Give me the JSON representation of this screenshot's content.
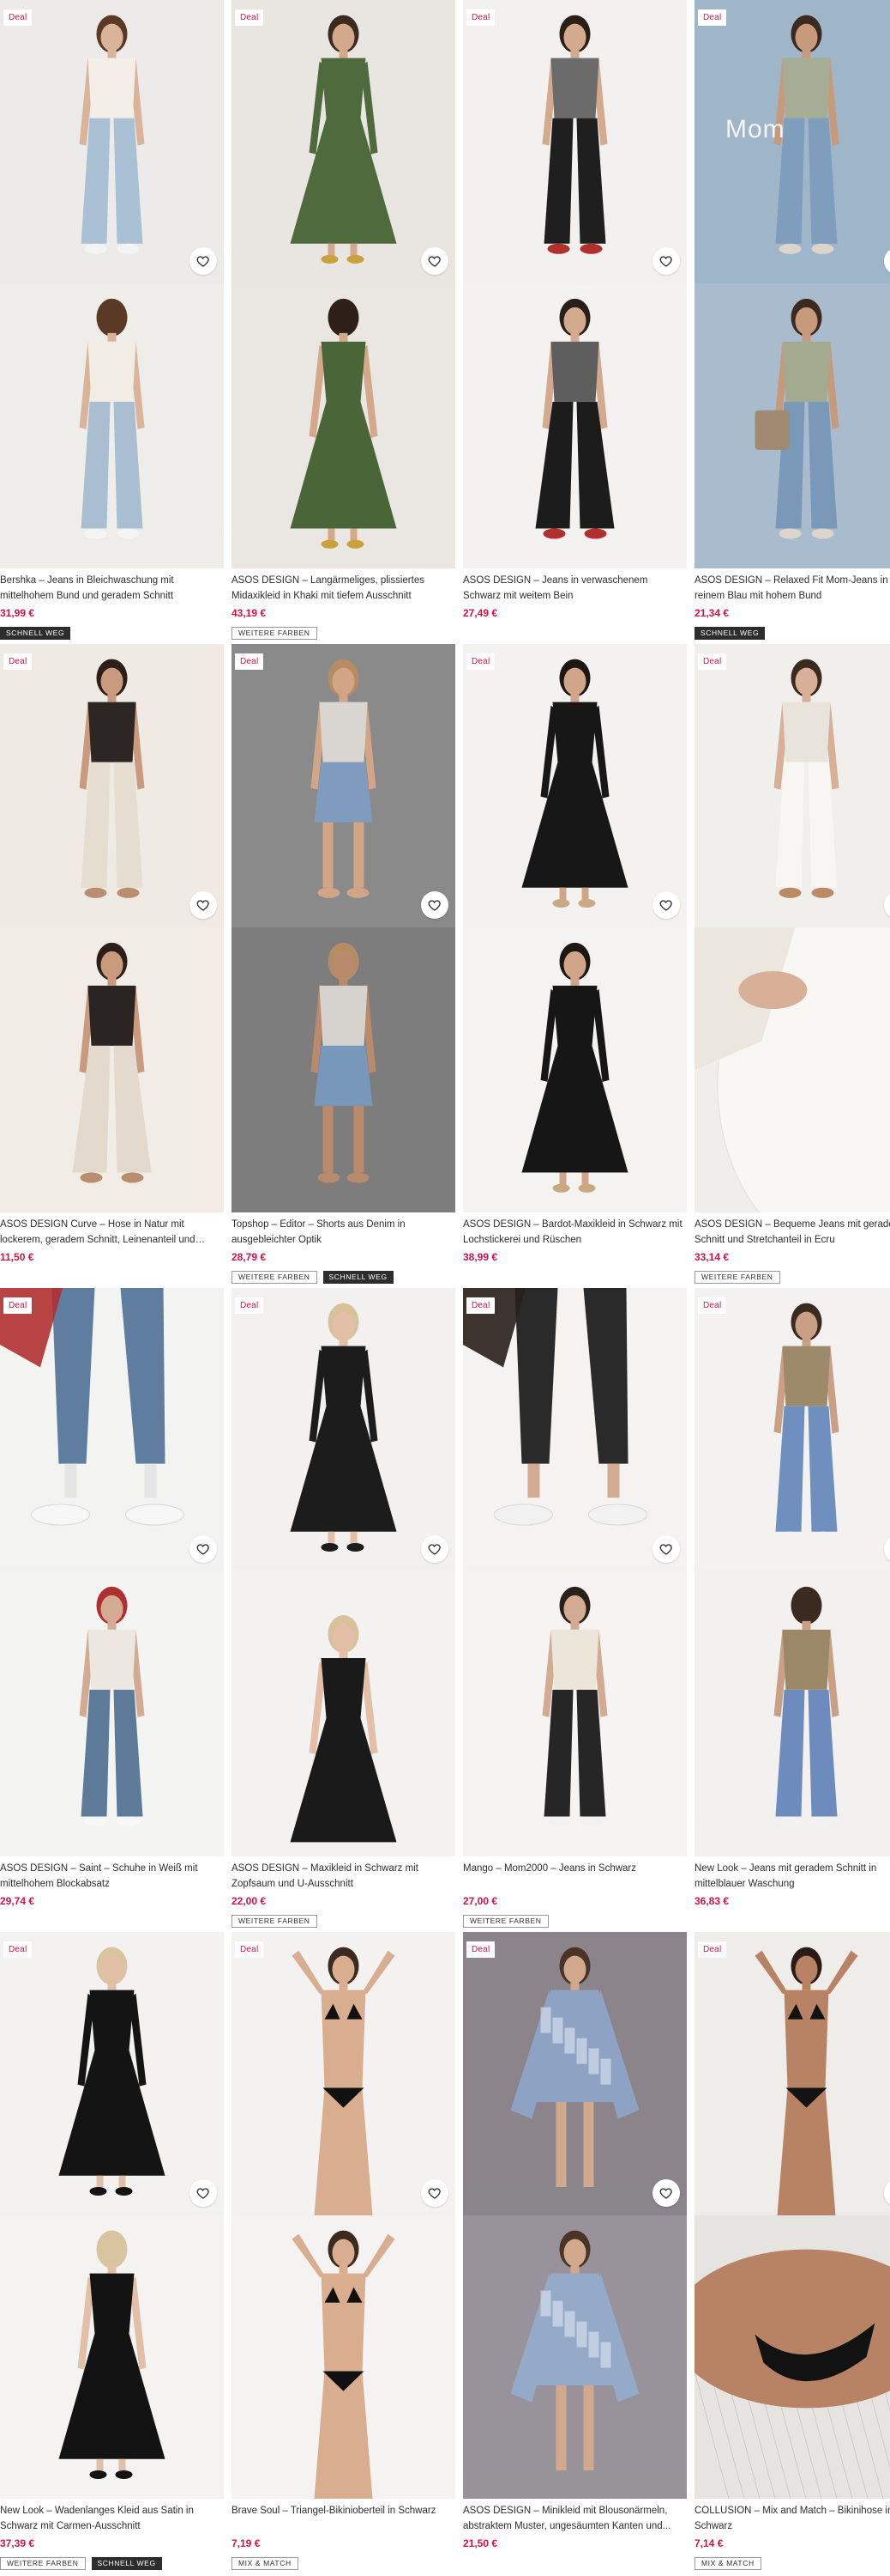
{
  "colors": {
    "price": "#d01345",
    "deal_text": "#d01345",
    "text": "#2d2d2d",
    "badge_dark": "#2d2d2d"
  },
  "rows": [
    {
      "products": [
        {
          "deal": "Deal",
          "title": "Bershka – Jeans in Bleichwaschung mit mittelhohem Bund und geradem Schnitt",
          "price": "31,99 €",
          "badges": [
            {
              "label": "Schnell weg",
              "style": "dark"
            }
          ],
          "photos": [
            {
              "bg": "#ecebe9",
              "top": "#f3efe8",
              "bottom": "#aac0d4",
              "hair": "#5a3a24",
              "skin": "#d9b49b",
              "shoes": "#f4f4f4",
              "pose": "stand"
            },
            {
              "bg": "#efedea",
              "top": "#f1ede4",
              "bottom": "#a9bfd1",
              "hair": "#5a3a24",
              "skin": "#d9b49b",
              "shoes": "#f4f4f4",
              "pose": "back"
            }
          ]
        },
        {
          "deal": "Deal",
          "title": "ASOS DESIGN – Langärmeliges, plissiertes Midaxikleid in Khaki mit tiefem Ausschnitt",
          "price": "43,19 €",
          "badges": [
            {
              "label": "Weitere Farben",
              "style": "outline"
            }
          ],
          "photos": [
            {
              "bg": "#e9e6e2",
              "top": "#4f6a3d",
              "bottom": "#4f6a3d",
              "hair": "#3a2a20",
              "skin": "#d4a88a",
              "shoes": "#c9a23b",
              "pose": "dress"
            },
            {
              "bg": "#eae7e3",
              "top": "#4a6538",
              "bottom": "#4a6538",
              "hair": "#2e2018",
              "skin": "#d4a88a",
              "shoes": "#c9a23b",
              "pose": "dressback"
            }
          ]
        },
        {
          "deal": "Deal",
          "title": "ASOS DESIGN – Jeans in verwaschenem Schwarz mit weitem Bein",
          "price": "27,49 €",
          "badges": [],
          "photos": [
            {
              "bg": "#f2f1f0",
              "top": "#6b6b6b",
              "bottom": "#1f1f1f",
              "hair": "#2a1e18",
              "skin": "#d3aa8e",
              "shoes": "#b0302c",
              "pose": "stand"
            },
            {
              "bg": "#f3f2f1",
              "top": "#5e5e5e",
              "bottom": "#1c1c1c",
              "hair": "#2a1e18",
              "skin": "#d3aa8e",
              "shoes": "#b0302c",
              "pose": "wide"
            }
          ]
        },
        {
          "deal": "Deal",
          "overlay": "Mom",
          "title": "ASOS DESIGN – Relaxed Fit Mom-Jeans in reinem Blau mit hohem Bund",
          "price": "21,34 €",
          "badges": [
            {
              "label": "Schnell weg",
              "style": "dark"
            }
          ],
          "photos": [
            {
              "bg": "#9fb6c9",
              "top": "#a5ad94",
              "bottom": "#7f9dbd",
              "hair": "#3b2a1f",
              "skin": "#c79a7c",
              "shoes": "#ddd5cc",
              "pose": "stand"
            },
            {
              "bg": "#a8bccd",
              "top": "#a2aa8f",
              "bottom": "#7a98b8",
              "hair": "#3b2a1f",
              "skin": "#c79a7c",
              "shoes": "#ddd5cc",
              "pose": "bag"
            }
          ]
        }
      ]
    },
    {
      "products": [
        {
          "deal": "Deal",
          "title": "ASOS DESIGN Curve – Hose in Natur mit lockerem, geradem Schnitt, Leinenanteil und welligem...",
          "price": "11,50 €",
          "badges": [],
          "photos": [
            {
              "bg": "#efeae4",
              "top": "#2c2624",
              "bottom": "#e6ddd1",
              "hair": "#2c1f19",
              "skin": "#c99a7e",
              "shoes": "#b88e6e",
              "pose": "stand"
            },
            {
              "bg": "#f1ece6",
              "top": "#2a2422",
              "bottom": "#e3d9cc",
              "hair": "#2c1f19",
              "skin": "#c99a7e",
              "shoes": "#b88e6e",
              "pose": "wide"
            }
          ]
        },
        {
          "deal": "Deal",
          "title": "Topshop – Editor – Shorts aus Denim in ausgebleichter Optik",
          "price": "28,79 €",
          "badges": [
            {
              "label": "Weitere Farben",
              "style": "outline"
            },
            {
              "label": "Schnell weg",
              "style": "dark"
            }
          ],
          "photos": [
            {
              "bg": "#8a8a8a",
              "top": "#d9d6d1",
              "bottom": "#7f9cbe",
              "hair": "#b68c62",
              "skin": "#d2a587",
              "shoes": "#d2a587",
              "pose": "shorts"
            },
            {
              "bg": "#7d7d7d",
              "top": "#d6d3ce",
              "bottom": "#7898bb",
              "hair": "#b68c62",
              "skin": "#b98a6c",
              "shoes": "#b98a6c",
              "pose": "shortsclose"
            }
          ]
        },
        {
          "deal": "Deal",
          "title": "ASOS DESIGN – Bardot-Maxikleid in Schwarz mit Lochstickerei und Rüschen",
          "price": "38,99 €",
          "badges": [],
          "photos": [
            {
              "bg": "#f3f2f0",
              "top": "#171717",
              "bottom": "#171717",
              "hair": "#1e1612",
              "skin": "#d0a58a",
              "shoes": "#c9a981",
              "pose": "dress"
            },
            {
              "bg": "#f4f3f1",
              "top": "#161616",
              "bottom": "#161616",
              "hair": "#1e1612",
              "skin": "#d0a58a",
              "shoes": "#c9a981",
              "pose": "dress"
            }
          ]
        },
        {
          "deal": "Deal",
          "title": "ASOS DESIGN – Bequeme Jeans mit geradem Schnitt und Stretchanteil in Ecru",
          "price": "33,14 €",
          "badges": [
            {
              "label": "Weitere Farben",
              "style": "outline"
            }
          ],
          "photos": [
            {
              "bg": "#f1efec",
              "top": "#e8e4dc",
              "bottom": "#f7f6f3",
              "hair": "#3a2a20",
              "skin": "#d7b097",
              "shoes": "#b98a64",
              "pose": "stand"
            },
            {
              "bg": "#f0eeeb",
              "top": "#ebe7df",
              "bottom": "#f8f7f4",
              "hair": "#3a2a20",
              "skin": "#d7b097",
              "shoes": "#b98a64",
              "pose": "closeup"
            }
          ]
        }
      ]
    },
    {
      "products": [
        {
          "deal": "Deal",
          "title": "ASOS DESIGN – Saint – Schuhe in Weiß mit mittelhohem Blockabsatz",
          "price": "29,74 €",
          "badges": [],
          "photos": [
            {
              "bg": "#f3f3f2",
              "top": "#5f7d9e",
              "bottom": "#5f7d9e",
              "hair": "#b03030",
              "skin": "#e5e5e5",
              "shoes": "#f7f7f7",
              "pose": "legs"
            },
            {
              "bg": "#f4f4f3",
              "top": "#ece7e0",
              "bottom": "#5d7a99",
              "hair": "#b03030",
              "skin": "#d2ab92",
              "shoes": "#f7f7f7",
              "pose": "stand"
            }
          ]
        },
        {
          "deal": "Deal",
          "title": "ASOS DESIGN – Maxikleid in Schwarz mit Zopfsaum und U-Ausschnitt",
          "price": "22,00 €",
          "badges": [
            {
              "label": "Weitere Farben",
              "style": "outline"
            }
          ],
          "photos": [
            {
              "bg": "#f2f1ef",
              "top": "#1c1c1c",
              "bottom": "#1c1c1c",
              "hair": "#d7c29c",
              "skin": "#e2bfa6",
              "shoes": "#1c1c1c",
              "pose": "dress"
            },
            {
              "bg": "#f3f2f0",
              "top": "#1a1a1a",
              "bottom": "#1a1a1a",
              "hair": "#d7c29c",
              "skin": "#e2bfa6",
              "shoes": "#1a1a1a",
              "pose": "sit"
            }
          ]
        },
        {
          "deal": "Deal",
          "title": "Mango – Mom2000 – Jeans in Schwarz",
          "price": "27,00 €",
          "badges": [
            {
              "label": "Weitere Farben",
              "style": "outline"
            }
          ],
          "photos": [
            {
              "bg": "#f4f3f2",
              "top": "#efe9df",
              "bottom": "#2a2a2a",
              "hair": "#2a1f19",
              "skin": "#d2ab92",
              "shoes": "#f2f2f2",
              "pose": "legs"
            },
            {
              "bg": "#f5f4f3",
              "top": "#ece5da",
              "bottom": "#262626",
              "hair": "#2a1f19",
              "skin": "#d2ab92",
              "shoes": "#f2f2f2",
              "pose": "stand"
            }
          ]
        },
        {
          "deal": "Deal",
          "title": "New Look – Jeans mit geradem Schnitt in mittelblauer Waschung",
          "price": "36,83 €",
          "badges": [],
          "photos": [
            {
              "bg": "#f3f2f1",
              "top": "#9c8a6a",
              "bottom": "#6f8fbf",
              "hair": "#3a2a20",
              "skin": "#c9a085",
              "shoes": "#f2f2f2",
              "pose": "stand"
            },
            {
              "bg": "#f2f1f0",
              "top": "#9a8867",
              "bottom": "#6d8cbd",
              "hair": "#3a2a20",
              "skin": "#c9a085",
              "shoes": "#f2f2f2",
              "pose": "back"
            }
          ]
        }
      ]
    },
    {
      "products": [
        {
          "deal": "Deal",
          "title": "New Look – Wadenlanges Kleid aus Satin in Schwarz mit Carmen-Ausschnitt",
          "price": "37,39 €",
          "badges": [
            {
              "label": "Weitere Farben",
              "style": "outline"
            },
            {
              "label": "Schnell weg",
              "style": "dark"
            }
          ],
          "photos": [
            {
              "bg": "#f3f2f1",
              "top": "#141414",
              "bottom": "#141414",
              "hair": "#d9c4a0",
              "skin": "#e2c0a8",
              "shoes": "#141414",
              "pose": "dress"
            },
            {
              "bg": "#f4f3f2",
              "top": "#131313",
              "bottom": "#131313",
              "hair": "#d9c4a0",
              "skin": "#e2c0a8",
              "shoes": "#131313",
              "pose": "dressback"
            }
          ]
        },
        {
          "deal": "Deal",
          "title": "Brave Soul – Triangel-Bikinioberteil in Schwarz",
          "price": "7,19 €",
          "badges": [
            {
              "label": "Mix & Match",
              "style": "outline"
            }
          ],
          "photos": [
            {
              "bg": "#f3f2f1",
              "top": "#111111",
              "bottom": "#111111",
              "hair": "#3b2a1f",
              "skin": "#d9ad8f",
              "shoes": "#d9ad8f",
              "pose": "bikini"
            },
            {
              "bg": "#f4f3f2",
              "top": "#101010",
              "bottom": "#101010",
              "hair": "#3b2a1f",
              "skin": "#d9ad8f",
              "shoes": "#d9ad8f",
              "pose": "bikiniclose"
            }
          ]
        },
        {
          "deal": "Deal",
          "title": "ASOS DESIGN – Minikleid mit Blousonärmeln, abstraktem Muster, ungesäumten Kanten und...",
          "price": "21,50 €",
          "badges": [],
          "photos": [
            {
              "bg": "#8b858b",
              "top": "#8ea3c4",
              "bottom": "#8ea3c4",
              "hair": "#4a3428",
              "skin": "#d2a98d",
              "shoes": "#d2a98d",
              "pose": "mini"
            },
            {
              "bg": "#98929a",
              "top": "#95a9c8",
              "bottom": "#95a9c8",
              "hair": "#4a3428",
              "skin": "#d2a98d",
              "shoes": "#d2a98d",
              "pose": "minib"
            }
          ]
        },
        {
          "deal": "Deal",
          "title": "COLLUSION – Mix and Match – Bikinihose in Schwarz",
          "price": "7,14 €",
          "badges": [
            {
              "label": "Mix & Match",
              "style": "outline"
            }
          ],
          "photos": [
            {
              "bg": "#efedea",
              "top": "#121212",
              "bottom": "#121212",
              "hair": "#2a1c15",
              "skin": "#b88364",
              "shoes": "#b88364",
              "pose": "bikini"
            },
            {
              "bg": "#e6e4e1",
              "top": "#121212",
              "bottom": "#121212",
              "hair": "#2a1c15",
              "skin": "#b88364",
              "shoes": "#b88364",
              "pose": "lie"
            }
          ]
        }
      ]
    }
  ]
}
